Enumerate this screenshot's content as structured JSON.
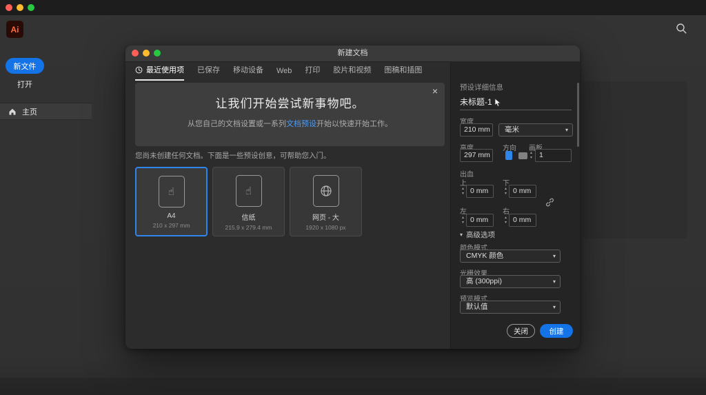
{
  "colors": {
    "accent": "#1473e6",
    "link": "#4f9cf6",
    "selection_border": "#2f86ec"
  },
  "icons": {
    "close": "×",
    "chevron_down": "▾",
    "step_up": "▴",
    "step_down": "▾",
    "hand": "☝"
  },
  "sidebar": {
    "logo": "Ai",
    "new_file": "新文件",
    "open": "打开",
    "home": "主页"
  },
  "dialog": {
    "title": "新建文档",
    "tabs": [
      {
        "label": "最近使用项"
      },
      {
        "label": "已保存"
      },
      {
        "label": "移动设备"
      },
      {
        "label": "Web"
      },
      {
        "label": "打印"
      },
      {
        "label": "胶片和视频"
      },
      {
        "label": "图稿和插图"
      }
    ],
    "banner": {
      "heading": "让我们开始尝试新事物吧。",
      "sub_before": "从您自己的文档设置或一系列",
      "link": "文档预设",
      "sub_after": "开始以快速开始工作。"
    },
    "hint": "您尚未创建任何文档。下面是一些预设创意，可帮助您入门。",
    "presets": [
      {
        "name": "A4",
        "dims": "210 x 297 mm"
      },
      {
        "name": "信纸",
        "dims": "215.9 x 279.4 mm"
      },
      {
        "name": "网页 - 大",
        "dims": "1920 x 1080 px"
      }
    ],
    "details": {
      "title": "预设详细信息",
      "doc_name": "未标题-1",
      "width_label": "宽度",
      "width_value": "210 mm",
      "unit_value": "毫米",
      "height_label": "高度",
      "height_value": "297 mm",
      "orientation_label": "方向",
      "artboard_label": "画板",
      "artboard_value": "1",
      "bleed_label": "出血",
      "top_label": "上",
      "top_value": "0 mm",
      "bottom_label": "下",
      "bottom_value": "0 mm",
      "left_label": "左",
      "left_value": "0 mm",
      "right_label": "右",
      "right_value": "0 mm",
      "advanced_label": "高级选项",
      "color_mode_label": "颜色模式",
      "color_mode_value": "CMYK 颜色",
      "raster_label": "光栅效果",
      "raster_value": "高 (300ppi)",
      "preview_label": "预览模式",
      "preview_value": "默认值",
      "close_button": "关闭",
      "create_button": "创建"
    }
  }
}
